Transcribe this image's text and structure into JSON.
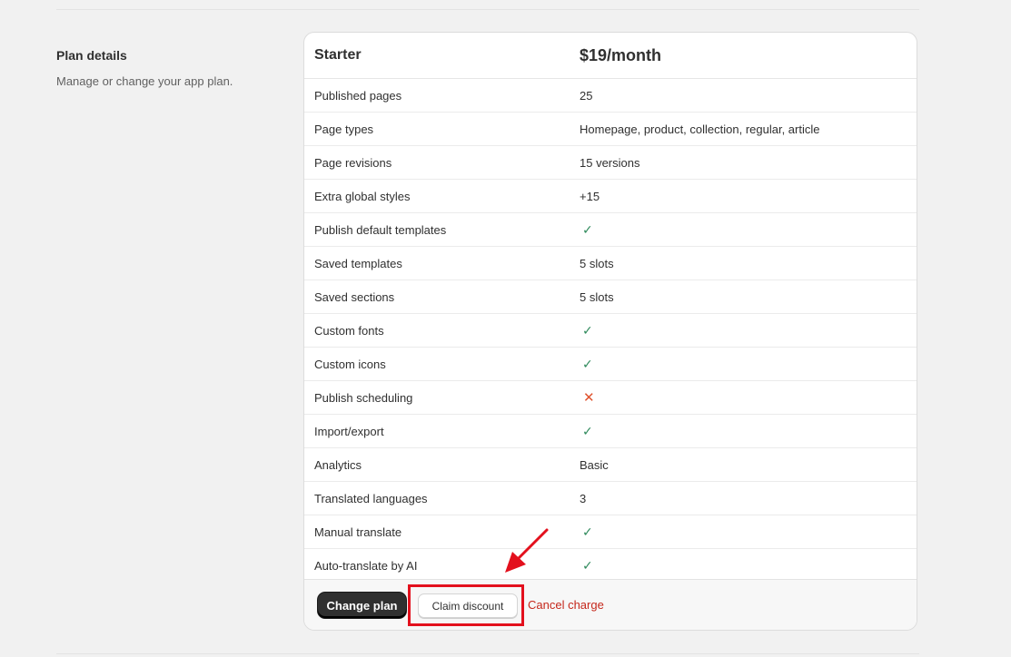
{
  "section": {
    "title": "Plan details",
    "description": "Manage or change your app plan."
  },
  "plan": {
    "name": "Starter",
    "price": "$19/month"
  },
  "features": [
    {
      "label": "Published pages",
      "value": "25",
      "type": "text"
    },
    {
      "label": "Page types",
      "value": "Homepage, product, collection, regular, article",
      "type": "text"
    },
    {
      "label": "Page revisions",
      "value": "15 versions",
      "type": "text"
    },
    {
      "label": "Extra global styles",
      "value": "+15",
      "type": "text"
    },
    {
      "label": "Publish default templates",
      "value": "✓",
      "type": "check"
    },
    {
      "label": "Saved templates",
      "value": "5 slots",
      "type": "text"
    },
    {
      "label": "Saved sections",
      "value": "5 slots",
      "type": "text"
    },
    {
      "label": "Custom fonts",
      "value": "✓",
      "type": "check"
    },
    {
      "label": "Custom icons",
      "value": "✓",
      "type": "check"
    },
    {
      "label": "Publish scheduling",
      "value": "✕",
      "type": "cross"
    },
    {
      "label": "Import/export",
      "value": "✓",
      "type": "check"
    },
    {
      "label": "Analytics",
      "value": "Basic",
      "type": "text"
    },
    {
      "label": "Translated languages",
      "value": "3",
      "type": "text"
    },
    {
      "label": "Manual translate",
      "value": "✓",
      "type": "check"
    },
    {
      "label": "Auto-translate by AI",
      "value": "✓",
      "type": "check"
    }
  ],
  "footer": {
    "change_plan_label": "Change plan",
    "claim_discount_label": "Claim discount",
    "cancel_charge_label": "Cancel charge"
  },
  "icons": {
    "included": "check-icon",
    "excluded": "cross-icon"
  },
  "colors": {
    "check": "#2f8a5c",
    "cross": "#e0532f",
    "primary_button": "#303030",
    "cancel_link": "#c5281c",
    "annotation": "#e3101d"
  }
}
